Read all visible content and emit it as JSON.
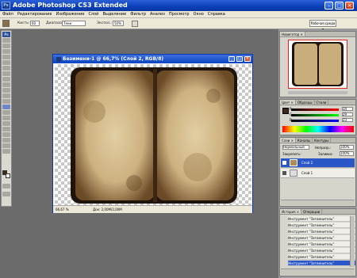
{
  "app": {
    "title": "Adobe Photoshop CS3 Extended",
    "icon": "ps-icon",
    "accent": "#0a3fb8"
  },
  "menu": [
    "Файл",
    "Редактирование",
    "Изображение",
    "Слой",
    "Выделение",
    "Фильтр",
    "Анализ",
    "Просмотр",
    "Окно",
    "Справка"
  ],
  "options": {
    "brush_label": "Кисть:",
    "brush_size": "60",
    "range_label": "Диапазон:",
    "range_value": "Тени",
    "exposure_label": "Экспоз.:",
    "exposure_value": "50%",
    "workspace": "Рабочая среда ▾"
  },
  "document": {
    "title": "Безимени-1 @ 66,7% (Слой 2, RGB/8)",
    "zoom": "66,67 %",
    "doc_size": "Док: 2,00M/2,00M"
  },
  "navigator": {
    "tabs": [
      "Навигатор ×"
    ]
  },
  "color": {
    "tabs": [
      "Цвет ×",
      "Образцы",
      "Стили"
    ],
    "r": "R",
    "g": "G",
    "b": "B",
    "r_val": "34",
    "g_val": "29",
    "b_val": "23"
  },
  "layers": {
    "tabs": [
      "Слои ×",
      "Каналы",
      "Контуры"
    ],
    "blend": "Нормальный",
    "opacity_label": "Непрозр.:",
    "opacity": "100%",
    "lock_label": "Закрепить:",
    "fill_label": "Заливка:",
    "fill": "100%",
    "items": [
      {
        "name": "Слой 2",
        "selected": true
      },
      {
        "name": "Слой 1",
        "selected": false
      }
    ]
  },
  "history": {
    "tabs": [
      "История ×",
      "Операции"
    ],
    "items": [
      "Инструмент \"Затемнитель\"",
      "Инструмент \"Затемнитель\"",
      "Инструмент \"Затемнитель\"",
      "Инструмент \"Затемнитель\"",
      "Инструмент \"Затемнитель\"",
      "Инструмент \"Затемнитель\"",
      "Инструмент \"Затемнитель\"",
      "Инструмент \"Затемнитель\""
    ]
  }
}
